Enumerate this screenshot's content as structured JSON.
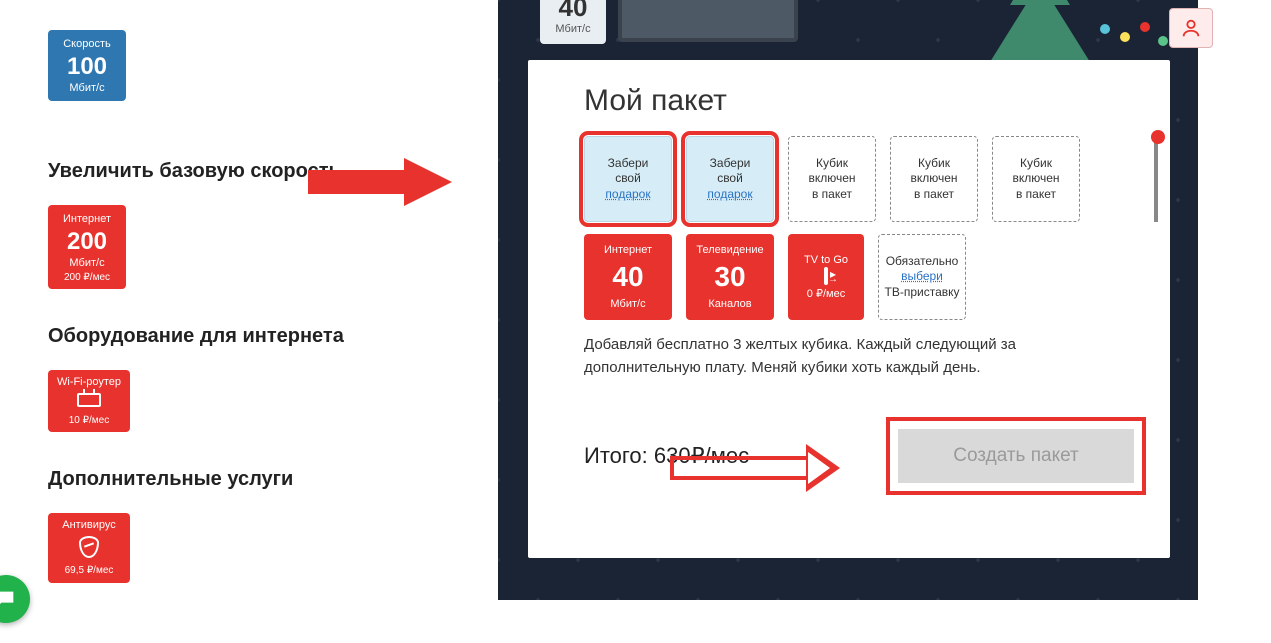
{
  "sidebar": {
    "speed_tile": {
      "label": "Скорость",
      "value": "100",
      "unit": "Мбит/с"
    },
    "sections": {
      "speed_up": {
        "title": "Увеличить базовую скорость",
        "tile": {
          "label": "Интернет",
          "value": "200",
          "unit": "Мбит/с",
          "price": "200 ₽/мес"
        }
      },
      "equipment": {
        "title": "Оборудование для интернета",
        "tile": {
          "label": "Wi-Fi-роутер",
          "price": "10 ₽/мес"
        }
      },
      "extra": {
        "title": "Дополнительные услуги",
        "tile": {
          "label": "Антивирус",
          "price": "69,5 ₽/мес"
        }
      }
    }
  },
  "package": {
    "top_speed": {
      "value": "40",
      "unit": "Мбит/с"
    },
    "title": "Мой пакет",
    "gift_cubes": [
      {
        "line1": "Забери",
        "line2": "свой",
        "link": "подарок"
      },
      {
        "line1": "Забери",
        "line2": "свой",
        "link": "подарок"
      }
    ],
    "placeholder_cube": {
      "l1": "Кубик",
      "l2": "включен",
      "l3": "в пакет"
    },
    "filled": {
      "internet": {
        "top": "Интернет",
        "mid": "40",
        "bot": "Мбит/с"
      },
      "tv": {
        "top": "Телевидение",
        "mid": "30",
        "bot": "Каналов"
      },
      "tvtogo": {
        "top": "TV to Go",
        "bot": "0 ₽/мес"
      }
    },
    "stb_cube": {
      "l1": "Обязательно",
      "link": "выбери",
      "l3": "ТВ-приставку"
    },
    "hint": "Добавляй бесплатно 3 желтых кубика. Каждый следующий за дополнительную плату. Меняй кубики хоть каждый день.",
    "total_label": "Итого: ",
    "total_value": "630₽/мес",
    "create_btn": "Создать пакет"
  }
}
